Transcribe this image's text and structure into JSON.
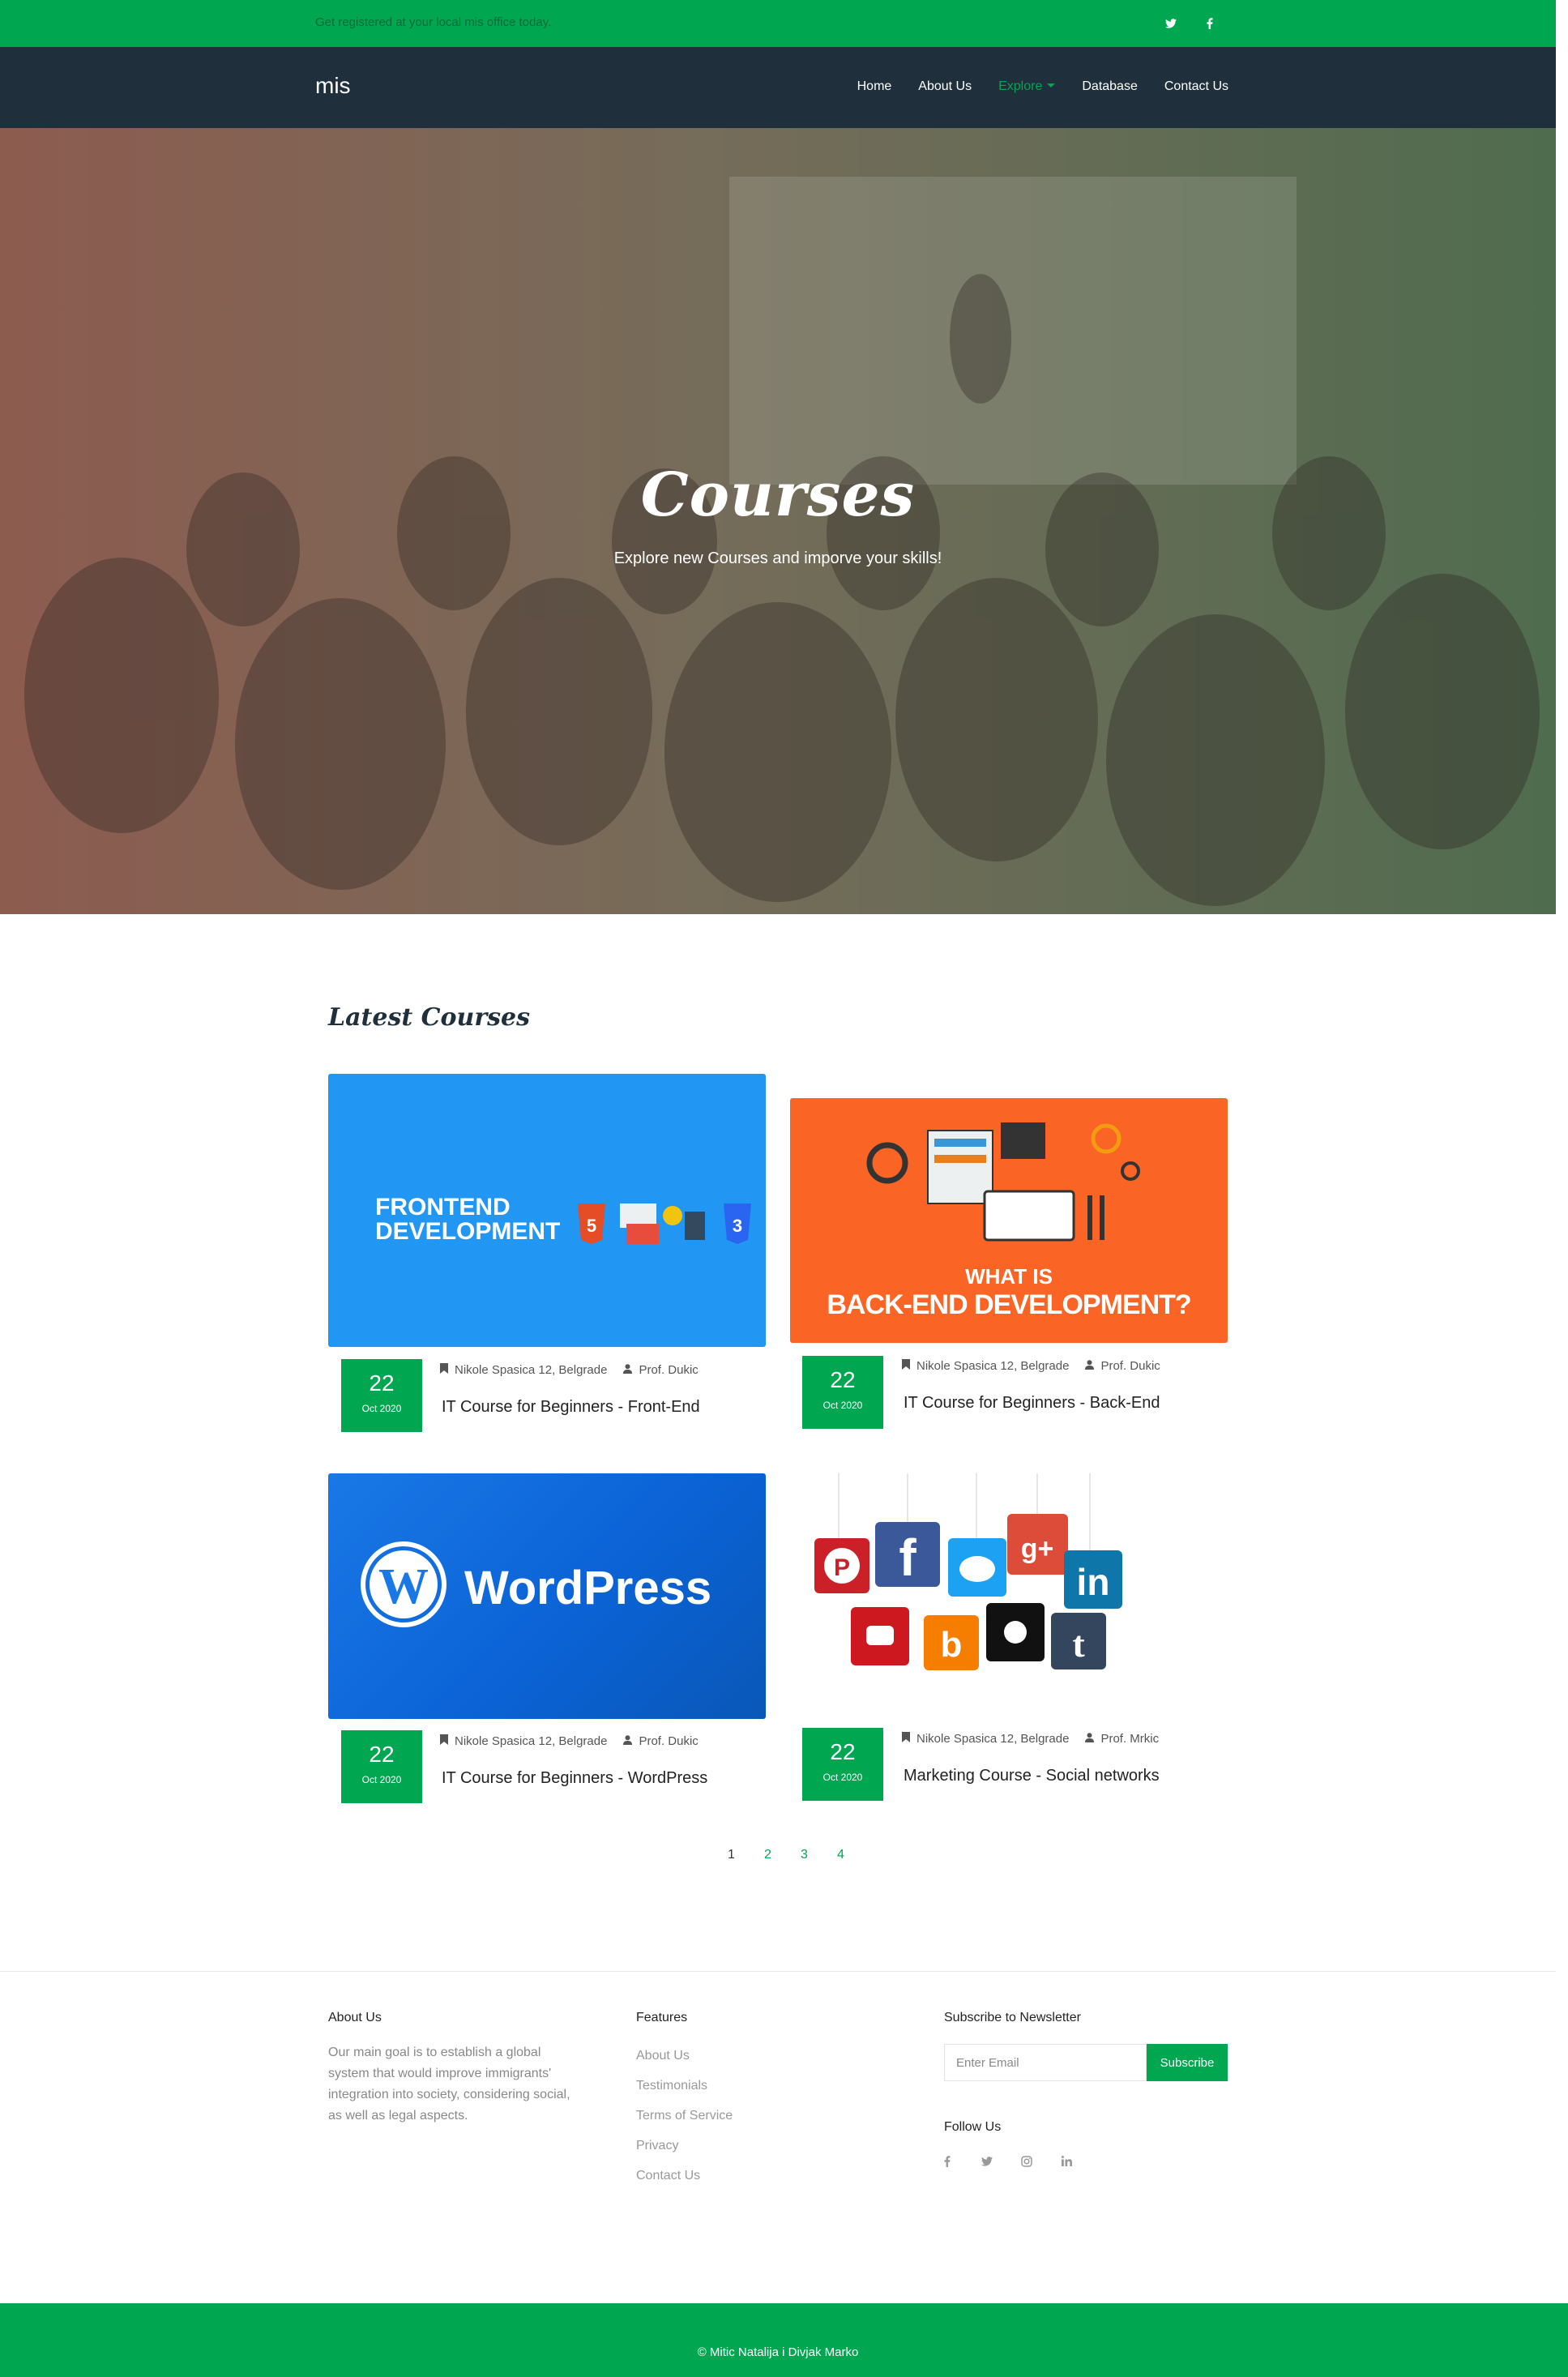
{
  "topbar": {
    "text": "Get registered at your local mis office today.",
    "social": [
      {
        "icon": "twitter-icon",
        "glyph": "🐦︎"
      },
      {
        "icon": "facebook-icon",
        "glyph": "f"
      }
    ]
  },
  "navbar": {
    "brand": "mis",
    "items": [
      "Home",
      "About Us",
      "Explore",
      "Database",
      "Contact Us"
    ],
    "active": "Explore"
  },
  "hero": {
    "title": "Courses",
    "subtitle": "Explore new Courses and imporve your skills!"
  },
  "latest": {
    "title": "Latest Courses",
    "courses": [
      {
        "day": "22",
        "month": "Oct 2020",
        "location": "Nikole Spasica 12, Belgrade",
        "teacher": "Prof. Dukic",
        "title": "IT Course for Beginners - Front-End",
        "image_text": [
          "FRONTEND",
          "DEVELOPMENT"
        ]
      },
      {
        "day": "22",
        "month": "Oct 2020",
        "location": "Nikole Spasica 12, Belgrade",
        "teacher": "Prof. Dukic",
        "title": "IT Course for Beginners - Back-End",
        "image_text": [
          "WHAT IS",
          "BACK-END DEVELOPMENT?"
        ]
      },
      {
        "day": "22",
        "month": "Oct 2020",
        "location": "Nikole Spasica 12, Belgrade",
        "teacher": "Prof. Dukic",
        "title": "IT Course for Beginners - WordPress",
        "image_text": [
          "WordPress"
        ]
      },
      {
        "day": "22",
        "month": "Oct 2020",
        "location": "Nikole Spasica 12, Belgrade",
        "teacher": "Prof. Mrkic",
        "title": "Marketing Course - Social networks",
        "image_text": []
      }
    ]
  },
  "pagination": {
    "pages": [
      "1",
      "2",
      "3",
      "4"
    ],
    "current": "1"
  },
  "footer": {
    "about": {
      "heading": "About Us",
      "text": "Our main goal is to establish a global system that would improve immigrants' integration into society, considering social, as well as legal aspects."
    },
    "features": {
      "heading": "Features",
      "links": [
        "About Us",
        "Testimonials",
        "Terms of Service",
        "Privacy",
        "Contact Us"
      ]
    },
    "newsletter": {
      "heading": "Subscribe to Newsletter",
      "placeholder": "Enter Email",
      "button": "Subscribe"
    },
    "follow": {
      "heading": "Follow Us",
      "icons": [
        "facebook-icon",
        "twitter-icon",
        "instagram-icon",
        "linkedin-icon"
      ]
    }
  },
  "copyright": "© Mitic Natalija i Divjak Marko",
  "colors": {
    "accent": "#00a650",
    "navbar": "#1f2f3b"
  }
}
